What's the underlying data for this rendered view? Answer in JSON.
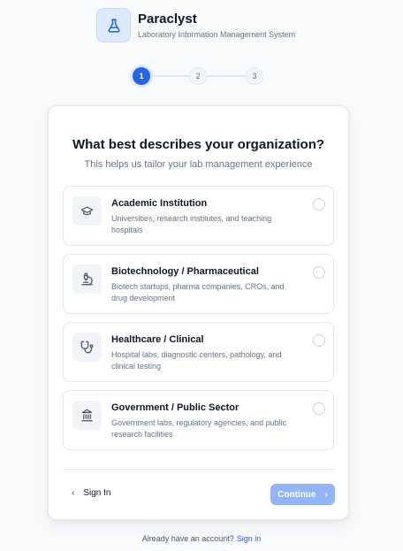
{
  "brand": {
    "name": "Paraclyst",
    "subtitle": "Laboratory Information Management System"
  },
  "stepper": {
    "steps": [
      "1",
      "2",
      "3"
    ],
    "current": 1
  },
  "card": {
    "title": "What best describes your organization?",
    "subtitle": "This helps us tailor your lab management experience"
  },
  "options": [
    {
      "icon": "graduation-cap-icon",
      "title": "Academic Institution",
      "description": "Universities, research institutes, and teaching hospitals",
      "selected": false
    },
    {
      "icon": "microscope-icon",
      "title": "Biotechnology / Pharmaceutical",
      "description": "Biotech startups, pharma companies, CROs, and drug development",
      "selected": false
    },
    {
      "icon": "stethoscope-icon",
      "title": "Healthcare / Clinical",
      "description": "Hospital labs, diagnostic centers, pathology, and clinical testing",
      "selected": false
    },
    {
      "icon": "government-building-icon",
      "title": "Government / Public Sector",
      "description": "Government labs, regulatory agencies, and public research facilities",
      "selected": false
    }
  ],
  "actions": {
    "back_label": "Sign In",
    "continue_label": "Continue"
  },
  "footer": {
    "prompt": "Already have an account?",
    "link": "Sign in"
  },
  "colors": {
    "accent": "#2563eb",
    "accent_disabled": "#93b4f9",
    "background": "#f8fafc"
  }
}
